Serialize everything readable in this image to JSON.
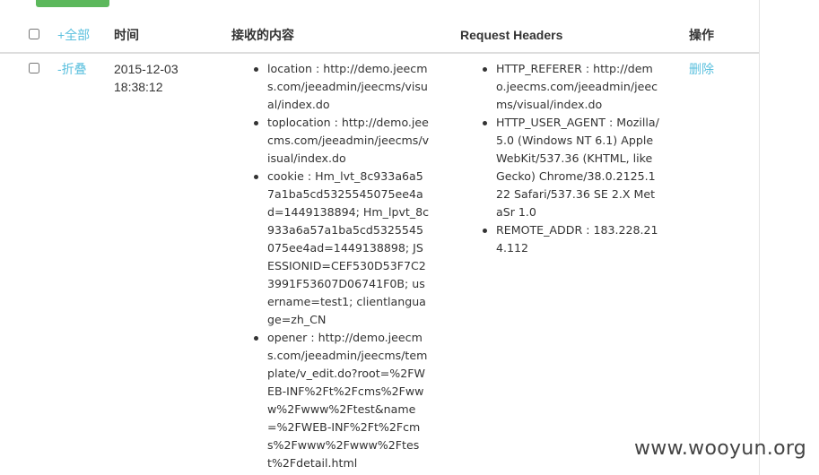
{
  "toolbar": {
    "action_button_label": ""
  },
  "header": {
    "expand_all": "+全部",
    "time": "时间",
    "content": "接收的内容",
    "request_headers": "Request Headers",
    "action": "操作"
  },
  "row": {
    "collapse": "-折叠",
    "date": "2015-12-03",
    "time": "18:38:12",
    "content": [
      "location : http://demo.jeecms.com/jeeadmin/jeecms/visual/index.do",
      "toplocation : http://demo.jeecms.com/jeeadmin/jeecms/visual/index.do",
      "cookie : Hm_lvt_8c933a6a57a1ba5cd5325545075ee4ad=1449138894; Hm_lpvt_8c933a6a57a1ba5cd5325545075ee4ad=1449138898; JSESSIONID=CEF530D53F7C23991F53607D06741F0B; username=test1; clientlanguage=zh_CN",
      "opener : http://demo.jeecms.com/jeeadmin/jeecms/template/v_edit.do?root=%2FWEB-INF%2Ft%2Fcms%2Fwww%2Fwww%2Ftest&name=%2FWEB-INF%2Ft%2Fcms%2Fwww%2Fwww%2Ftest%2Fdetail.html"
    ],
    "headers": [
      "HTTP_REFERER : http://demo.jeecms.com/jeeadmin/jeecms/visual/index.do",
      "HTTP_USER_AGENT : Mozilla/5.0 (Windows NT 6.1) AppleWebKit/537.36 (KHTML, like Gecko) Chrome/38.0.2125.122 Safari/537.36 SE 2.X MetaSr 1.0",
      "REMOTE_ADDR : 183.228.214.112"
    ],
    "delete": "删除"
  },
  "watermark": "www.wooyun.org",
  "colors": {
    "link": "#5bc0de",
    "button": "#5cb85c",
    "text": "#333333"
  }
}
